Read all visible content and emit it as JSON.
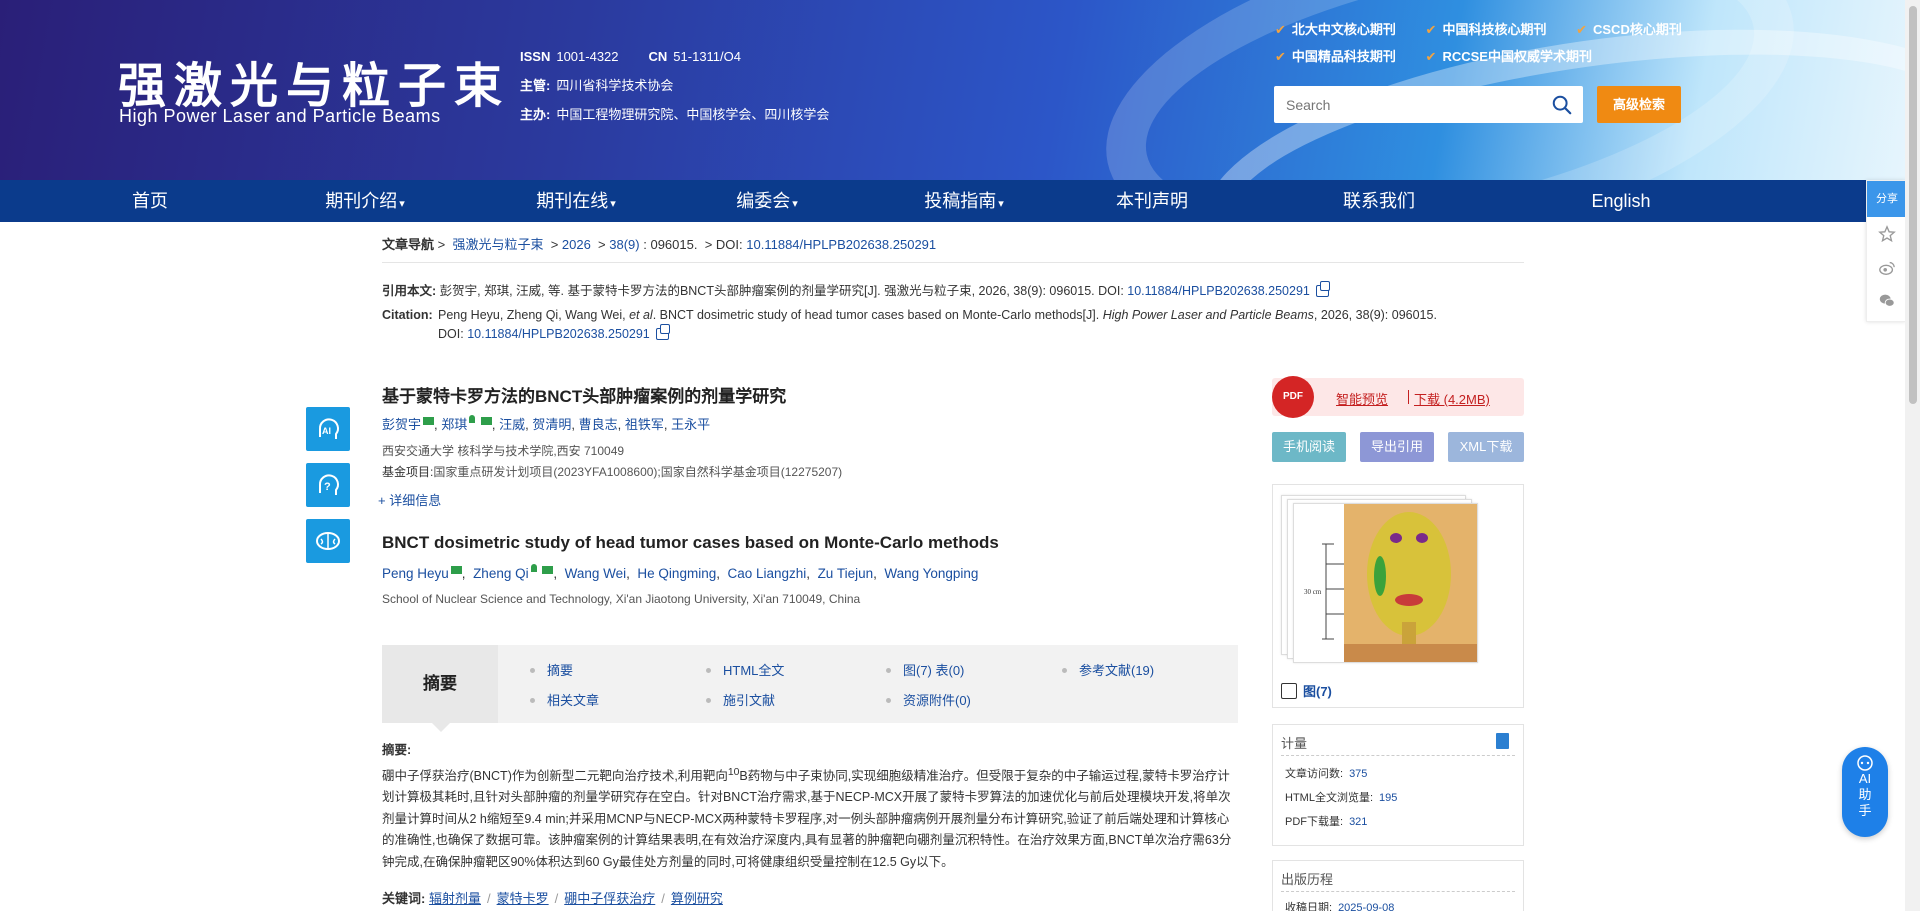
{
  "header": {
    "title_cn": "强激光与粒子束",
    "title_en": "High Power Laser and Particle Beams",
    "issn_label": "ISSN",
    "issn": "1001-4322",
    "cn_label": "CN",
    "cn": "51-1311/O4",
    "supervisor_label": "主管:",
    "supervisor": "四川省科学技术协会",
    "sponsor_label": "主办:",
    "sponsor": "中国工程物理研究院、中国核学会、四川核学会",
    "badges": [
      "北大中文核心期刊",
      "中国科技核心期刊",
      "CSCD核心期刊",
      "中国精品科技期刊",
      "RCCSE中国权威学术期刊"
    ],
    "search_placeholder": "Search",
    "advanced_search": "高级检索"
  },
  "nav": [
    {
      "label": "首页",
      "caret": false
    },
    {
      "label": "期刊介绍",
      "caret": true
    },
    {
      "label": "期刊在线",
      "caret": true
    },
    {
      "label": "编委会",
      "caret": true
    },
    {
      "label": "投稿指南",
      "caret": true
    },
    {
      "label": "本刊声明",
      "caret": false
    },
    {
      "label": "联系我们",
      "caret": false
    },
    {
      "label": "English",
      "caret": false
    }
  ],
  "breadcrumb": {
    "label": "文章导航",
    "journal": "强激光与粒子束",
    "year": "2026",
    "issue": "38(9)",
    "article_no": ": 096015.",
    "doi_label": "DOI:",
    "doi": "10.11884/HPLPB202638.250291"
  },
  "citation": {
    "cn_label": "引用本文:",
    "cn_text": "彭贺宇, 郑琪, 汪威, 等. 基于蒙特卡罗方法的BNCT头部肿瘤案例的剂量学研究[J]. 强激光与粒子束, 2026, 38(9): 096015. DOI:",
    "en_label": "Citation:",
    "en_text_1": "Peng Heyu, Zheng Qi, Wang Wei,",
    "en_etal": "et al",
    "en_text_2": ". BNCT dosimetric study of head tumor cases based on Monte-Carlo methods[J].",
    "en_journal": "High Power Laser and Particle Beams",
    "en_text_3": ", 2026, 38(9): 096015.",
    "en_doi_label": "DOI:",
    "doi": "10.11884/HPLPB202638.250291"
  },
  "article": {
    "title_cn": "基于蒙特卡罗方法的BNCT头部肿瘤案例的剂量学研究",
    "authors_cn": [
      "彭贺宇",
      "郑琪",
      "汪威",
      "贺清明",
      "曹良志",
      "祖铁军",
      "王永平"
    ],
    "affiliation_cn": "西安交通大学 核科学与技术学院,西安 710049",
    "fund_label": "基金项目:",
    "fund": "国家重点研发计划项目(2023YFA1008600);国家自然科学基金项目(12275207)",
    "detail": "+ 详细信息",
    "title_en": "BNCT dosimetric study of head tumor cases based on Monte-Carlo methods",
    "authors_en": [
      "Peng Heyu",
      "Zheng Qi",
      "Wang Wei",
      "He Qingming",
      "Cao Liangzhi",
      "Zu Tiejun",
      "Wang Yongping"
    ],
    "affiliation_en": "School of Nuclear Science and Technology, Xi'an Jiaotong University, Xi'an 710049, China"
  },
  "tabs": {
    "head": "摘要",
    "links": [
      "摘要",
      "HTML全文",
      "图(7) 表(0)",
      "参考文献(19)",
      "相关文章",
      "施引文献",
      "资源附件(0)"
    ]
  },
  "abstract": {
    "label": "摘要:",
    "part1": "硼中子俘获治疗(BNCT)作为创新型二元靶向治疗技术,利用靶向",
    "sup": "10",
    "part2": "B药物与中子束协同,实现细胞级精准治疗。但受限于复杂的中子输运过程,蒙特卡罗治疗计划计算极其耗时,且针对头部肿瘤的剂量学研究存在空白。针对BNCT治疗需求,基于NECP-MCX开展了蒙特卡罗算法的加速优化与前后处理模块开发,将单次剂量计算时间从2 h缩短至9.4 min;并采用MCNP与NECP-MCX两种蒙特卡罗程序,对一例头部肿瘤病例开展剂量分布计算研究,验证了前后端处理和计算核心的准确性,也确保了数据可靠。该肿瘤案例的计算结果表明,在有效治疗深度内,具有显著的肿瘤靶向硼剂量沉积特性。在治疗效果方面,BNCT单次治疗需63分钟完成,在确保肿瘤靶区90%体积达到60 Gy最佳处方剂量的同时,可将健康组织受量控制在12.5 Gy以下。"
  },
  "keywords": {
    "label": "关键词:",
    "items": [
      "辐射剂量",
      "蒙特卡罗",
      "硼中子俘获治疗",
      "算例研究"
    ]
  },
  "right": {
    "pdf_icon": "PDF",
    "preview": "智能预览",
    "download": "下载 (4.2MB)",
    "mobile": "手机阅读",
    "export": "导出引用",
    "xml": "XML下载",
    "fig_label": "图(7)",
    "metrics_head": "计量",
    "metrics": [
      {
        "label": "文章访问数:",
        "value": "375"
      },
      {
        "label": "HTML全文浏览量:",
        "value": "195"
      },
      {
        "label": "PDF下载量:",
        "value": "321"
      }
    ],
    "history_head": "出版历程",
    "received_label": "收稿日期:",
    "received": "2025-09-08"
  },
  "float": {
    "share": "分享",
    "ai_help": [
      "AI",
      "助",
      "手"
    ]
  },
  "figure": {
    "scale_label": "30 cm"
  },
  "colors": {
    "nav_bg": "#0b3b8c",
    "accent_orange": "#f08a12",
    "link_blue": "#1b4fa0",
    "pdf_red": "#d42525"
  }
}
